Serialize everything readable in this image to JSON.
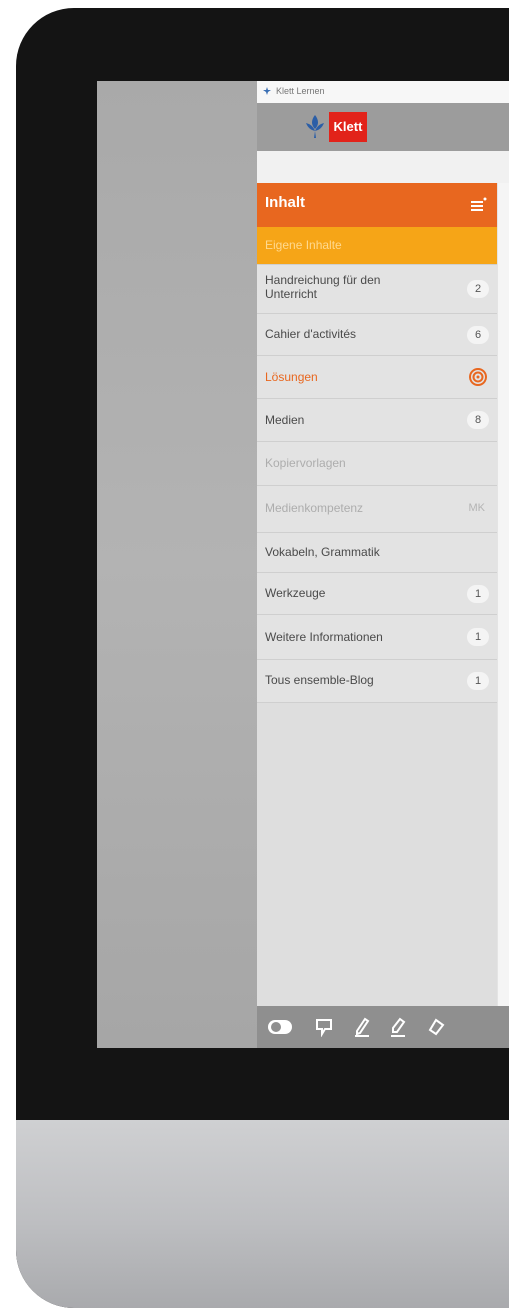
{
  "app": {
    "window_title": "Klett Lernen",
    "logo_text": "Klett"
  },
  "sidebar": {
    "title": "Inhalt",
    "menu_icon": "hamburger-menu-icon",
    "items": [
      {
        "label": "Eigene Inhalte",
        "badge": "",
        "state": "highlighted"
      },
      {
        "label": "Handreichung für den Unterricht",
        "badge": "2"
      },
      {
        "label": "Cahier d'activités",
        "badge": "6"
      },
      {
        "label": "Lösungen",
        "badge": "",
        "icon": "target-icon",
        "state": "accent"
      },
      {
        "label": "Medien",
        "badge": "8"
      },
      {
        "label": "Kopiervorlagen",
        "badge": "",
        "state": "disabled"
      },
      {
        "label": "Medienkompetenz",
        "badge": "MK",
        "state": "disabled"
      },
      {
        "label": "Vokabeln, Grammatik",
        "badge": ""
      },
      {
        "label": "Werkzeuge",
        "badge": "1"
      },
      {
        "label": "Weitere Informationen",
        "badge": "1"
      },
      {
        "label": "Tous ensemble-Blog",
        "badge": "1"
      }
    ]
  },
  "toolbar": {
    "tools": [
      "toggle-icon",
      "note-icon",
      "pen-icon",
      "highlighter-icon",
      "eraser-icon"
    ]
  },
  "colors": {
    "brand_orange": "#e8671f",
    "highlight_yellow": "#f6a517",
    "klett_red": "#e2231a"
  }
}
